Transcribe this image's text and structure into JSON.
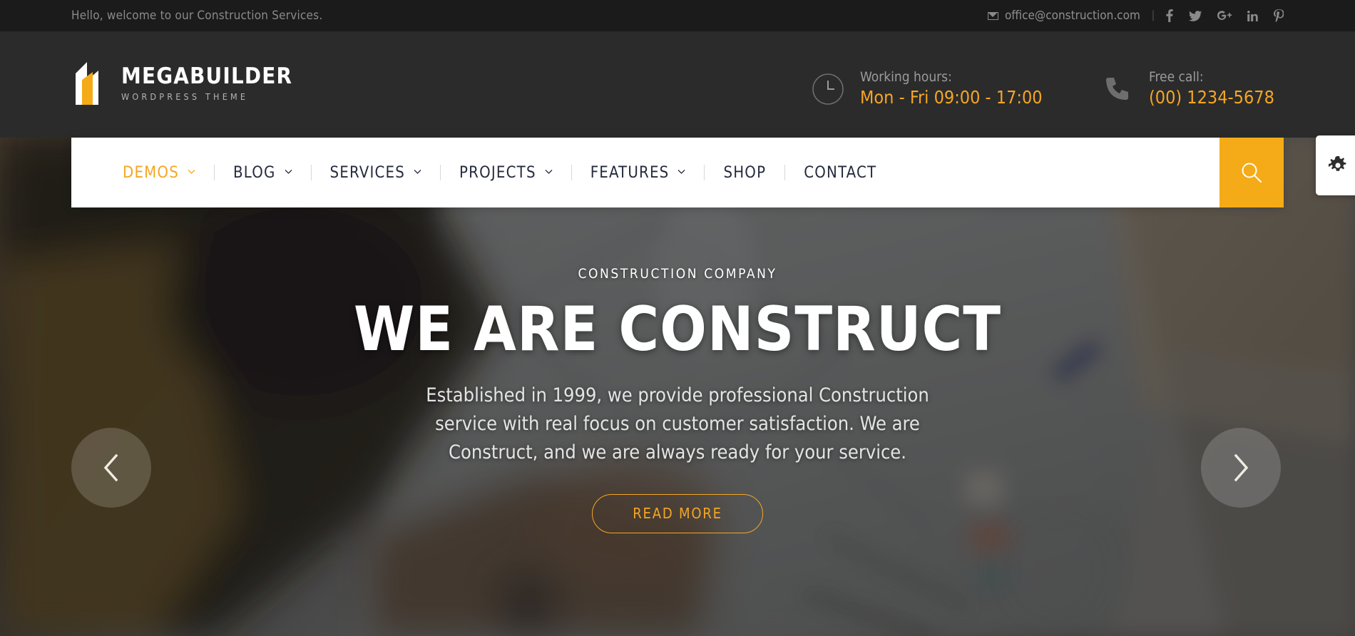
{
  "colors": {
    "accent": "#f5a623",
    "accent_search": "#f5ab17",
    "topbar_bg": "#1b1b1b",
    "header_bg": "#2b2b2b",
    "nav_text": "#242b3d",
    "nav_bg": "#ffffff"
  },
  "topbar": {
    "welcome": "Hello, welcome to our Construction Services.",
    "mail_icon": "mail-icon",
    "email": "office@construction.com",
    "separator": "|",
    "social": [
      {
        "name": "facebook-icon",
        "label": "f"
      },
      {
        "name": "twitter-icon",
        "label": "t"
      },
      {
        "name": "google-plus-icon",
        "label": "G+"
      },
      {
        "name": "linkedin-icon",
        "label": "in"
      },
      {
        "name": "pinterest-icon",
        "label": "P"
      }
    ]
  },
  "header": {
    "logo": {
      "icon": "building-logo-icon",
      "title": "MEGABUILDER",
      "subtitle": "WORDPRESS THEME"
    },
    "hours": {
      "icon": "clock-icon",
      "label": "Working hours:",
      "value": "Mon - Fri 09:00 - 17:00"
    },
    "phone": {
      "icon": "phone-icon",
      "label": "Free call:",
      "value": "(00) 1234-5678"
    }
  },
  "nav": {
    "items": [
      {
        "label": "DEMOS",
        "has_dropdown": true,
        "active": true
      },
      {
        "label": "BLOG",
        "has_dropdown": true,
        "active": false
      },
      {
        "label": "SERVICES",
        "has_dropdown": true,
        "active": false
      },
      {
        "label": "PROJECTS",
        "has_dropdown": true,
        "active": false
      },
      {
        "label": "FEATURES",
        "has_dropdown": true,
        "active": false
      },
      {
        "label": "SHOP",
        "has_dropdown": false,
        "active": false
      },
      {
        "label": "CONTACT",
        "has_dropdown": false,
        "active": false
      }
    ],
    "search_icon": "search-icon"
  },
  "settings_tab": {
    "icon": "gear-icon"
  },
  "hero": {
    "kicker": "CONSTRUCTION COMPANY",
    "title": "WE ARE CONSTRUCT",
    "description": "Established in 1999, we provide professional Construction service with real focus on customer satisfaction. We are Construct, and we are always ready for your service.",
    "button_label": "READ MORE",
    "prev_icon": "chevron-left-icon",
    "next_icon": "chevron-right-icon"
  }
}
